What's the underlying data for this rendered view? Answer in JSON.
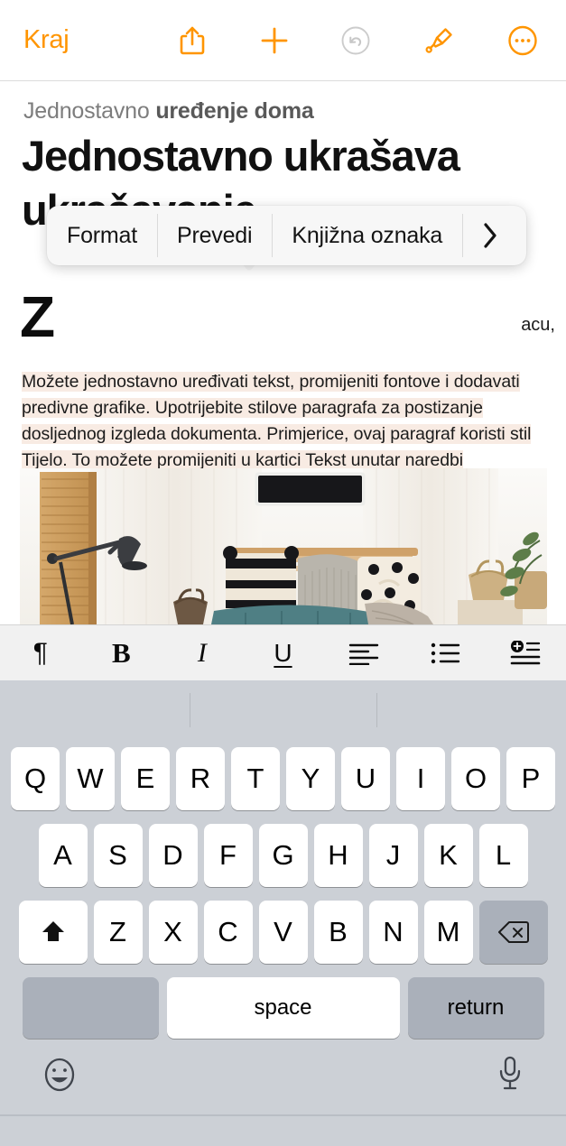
{
  "toolbar": {
    "done_label": "Kraj",
    "icons": [
      {
        "name": "share-icon",
        "label": "Share"
      },
      {
        "name": "plus-icon",
        "label": "Add"
      },
      {
        "name": "undo-icon",
        "label": "Undo",
        "state": "disabled"
      },
      {
        "name": "brush-icon",
        "label": "Format brush"
      },
      {
        "name": "more-icon",
        "label": "More"
      }
    ],
    "accent_color": "#ff9500",
    "disabled_color": "#c9c9c9"
  },
  "document": {
    "eyebrow_plain": "Jednostavno ",
    "eyebrow_bold": "uređenje doma",
    "headline": "Jednostavno ukrašava ukrašavanje",
    "dropcap": "Z",
    "hidden_line_right": "acu,",
    "body_paragraph": "Možete jednostavno uređivati tekst, promijeniti fontove i dodavati predivne grafike. Upotrijebite stilove paragrafa za postizanje dosljednog izgleda dokumenta. Primjerice, ovaj paragraf koristi stil Tijelo. To možete promijeniti u kartici Tekst unutar naredbi Formatiraj.",
    "selection_color": "#f8ebe3",
    "image_alt": "living-room-photo"
  },
  "context_menu": {
    "items": [
      {
        "label": "Format",
        "name": "menu-item-format"
      },
      {
        "label": "Prevedi",
        "name": "menu-item-prevedi"
      },
      {
        "label": "Knjižna oznaka",
        "name": "menu-item-knjizna-oznaka"
      }
    ],
    "more_chevron": "›"
  },
  "format_bar": {
    "buttons": [
      {
        "name": "paragraph-style-icon",
        "glyph": "¶"
      },
      {
        "name": "bold-icon",
        "glyph": "B"
      },
      {
        "name": "italic-icon",
        "glyph": "I"
      },
      {
        "name": "underline-icon",
        "glyph": "U"
      },
      {
        "name": "align-left-icon",
        "glyph": ""
      },
      {
        "name": "bullet-list-icon",
        "glyph": ""
      },
      {
        "name": "insert-icon",
        "glyph": ""
      }
    ]
  },
  "keyboard": {
    "row1": [
      "Q",
      "W",
      "E",
      "R",
      "T",
      "Y",
      "U",
      "I",
      "O",
      "P"
    ],
    "row2": [
      "A",
      "S",
      "D",
      "F",
      "G",
      "H",
      "J",
      "K",
      "L"
    ],
    "row3": [
      "Z",
      "X",
      "C",
      "V",
      "B",
      "N",
      "M"
    ],
    "shift_label": "",
    "backspace_label": "",
    "numbers_label": "",
    "space_label": "space",
    "return_label": "return",
    "emoji_icon": "emoji-icon",
    "mic_icon": "microphone-icon",
    "predictions": [
      "",
      "",
      ""
    ]
  }
}
